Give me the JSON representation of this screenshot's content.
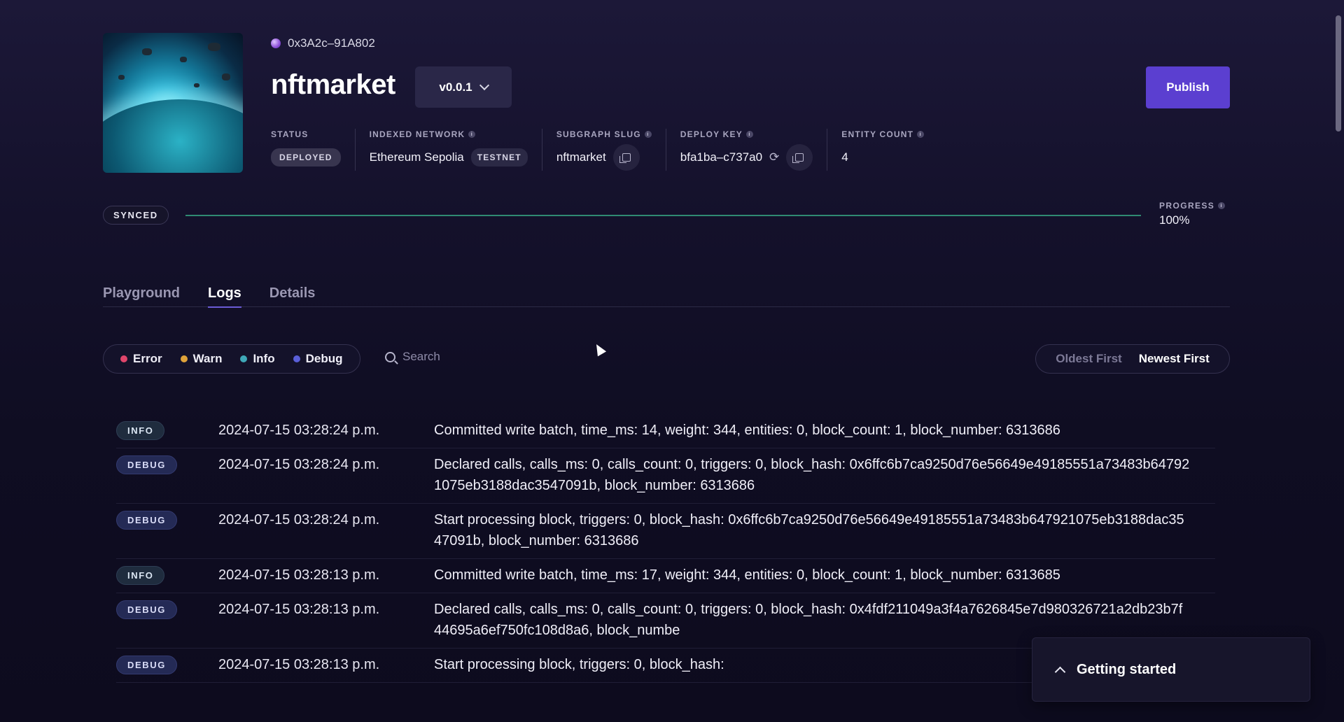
{
  "header": {
    "address": "0x3A2c–91A802",
    "title": "nftmarket",
    "version": "v0.0.1",
    "publish_label": "Publish"
  },
  "meta": {
    "status_label": "STATUS",
    "status_value": "DEPLOYED",
    "network_label": "INDEXED NETWORK",
    "network_value": "Ethereum Sepolia",
    "network_tag": "TESTNET",
    "slug_label": "SUBGRAPH SLUG",
    "slug_value": "nftmarket",
    "deploy_key_label": "DEPLOY KEY",
    "deploy_key_value": "bfa1ba–c737a0",
    "entity_label": "ENTITY COUNT",
    "entity_value": "4"
  },
  "sync": {
    "status": "SYNCED",
    "progress_label": "PROGRESS",
    "progress_value": "100%",
    "progress_fraction": 1.0
  },
  "tabs": [
    {
      "label": "Playground",
      "active": false
    },
    {
      "label": "Logs",
      "active": true
    },
    {
      "label": "Details",
      "active": false
    }
  ],
  "filters": [
    {
      "label": "Error",
      "color": "#e0456b"
    },
    {
      "label": "Warn",
      "color": "#e0a33a"
    },
    {
      "label": "Info",
      "color": "#3fa8b8"
    },
    {
      "label": "Debug",
      "color": "#5a5fd8"
    }
  ],
  "search": {
    "placeholder": "Search"
  },
  "sort": {
    "oldest": "Oldest First",
    "newest": "Newest First",
    "active": "newest"
  },
  "logs": [
    {
      "level": "INFO",
      "ts": "2024-07-15 03:28:24 p.m.",
      "msg": "Committed write batch, time_ms: 14, weight: 344, entities: 0, block_count: 1, block_number: 6313686"
    },
    {
      "level": "DEBUG",
      "ts": "2024-07-15 03:28:24 p.m.",
      "msg": "Declared calls, calls_ms: 0, calls_count: 0, triggers: 0, block_hash: 0x6ffc6b7ca9250d76e56649e49185551a73483b647921075eb3188dac3547091b, block_number: 6313686"
    },
    {
      "level": "DEBUG",
      "ts": "2024-07-15 03:28:24 p.m.",
      "msg": "Start processing block, triggers: 0, block_hash: 0x6ffc6b7ca9250d76e56649e49185551a73483b647921075eb3188dac3547091b, block_number: 6313686"
    },
    {
      "level": "INFO",
      "ts": "2024-07-15 03:28:13 p.m.",
      "msg": "Committed write batch, time_ms: 17, weight: 344, entities: 0, block_count: 1, block_number: 6313685"
    },
    {
      "level": "DEBUG",
      "ts": "2024-07-15 03:28:13 p.m.",
      "msg": "Declared calls, calls_ms: 0, calls_count: 0, triggers: 0, block_hash: 0x4fdf211049a3f4a7626845e7d980326721a2db23b7f44695a6ef750fc108d8a6, block_numbe"
    },
    {
      "level": "DEBUG",
      "ts": "2024-07-15 03:28:13 p.m.",
      "msg": "Start processing block, triggers: 0, block_hash:"
    }
  ],
  "getting_started": {
    "label": "Getting started"
  }
}
